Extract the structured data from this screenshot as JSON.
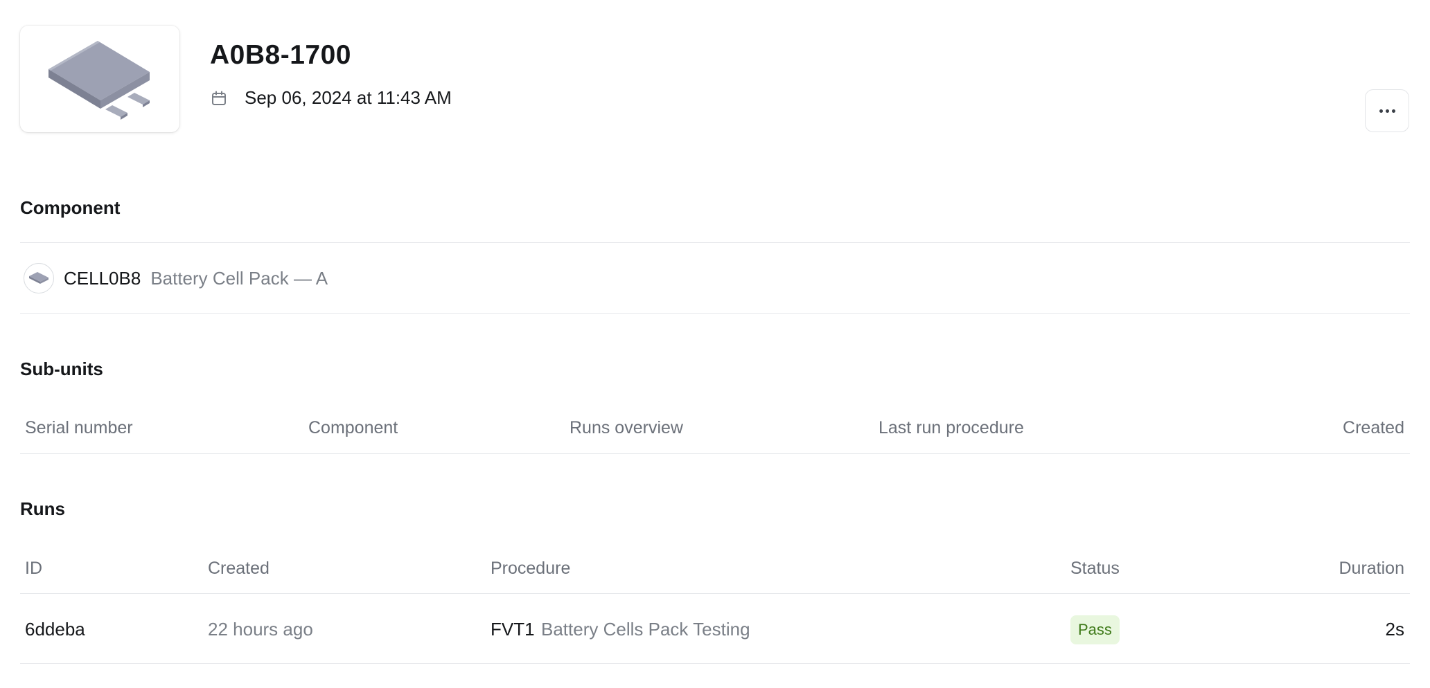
{
  "header": {
    "title": "A0B8-1700",
    "date": "Sep 06, 2024 at 11:43 AM"
  },
  "sections": {
    "component": "Component",
    "subunits": "Sub-units",
    "runs": "Runs"
  },
  "component": {
    "code": "CELL0B8",
    "name": "Battery Cell Pack — A"
  },
  "subunits_table": {
    "headers": [
      "Serial number",
      "Component",
      "Runs overview",
      "Last run procedure",
      "Created"
    ],
    "rows": []
  },
  "runs_table": {
    "headers": [
      "ID",
      "Created",
      "Procedure",
      "Status",
      "Duration"
    ],
    "rows": [
      {
        "id": "6ddeba",
        "created": "22 hours ago",
        "procedure_code": "FVT1",
        "procedure_name": "Battery Cells Pack Testing",
        "status": "Pass",
        "duration": "2s"
      }
    ]
  },
  "colors": {
    "pass_bg": "#e9f7df",
    "pass_text": "#3f7a1a",
    "muted_text": "#7a7f87",
    "divider": "#e6e8eb"
  },
  "icons": {
    "thumbnail": "battery-pack-image",
    "date": "calendar-icon",
    "more": "more-horizontal-icon",
    "component_avatar": "battery-pack-avatar"
  }
}
